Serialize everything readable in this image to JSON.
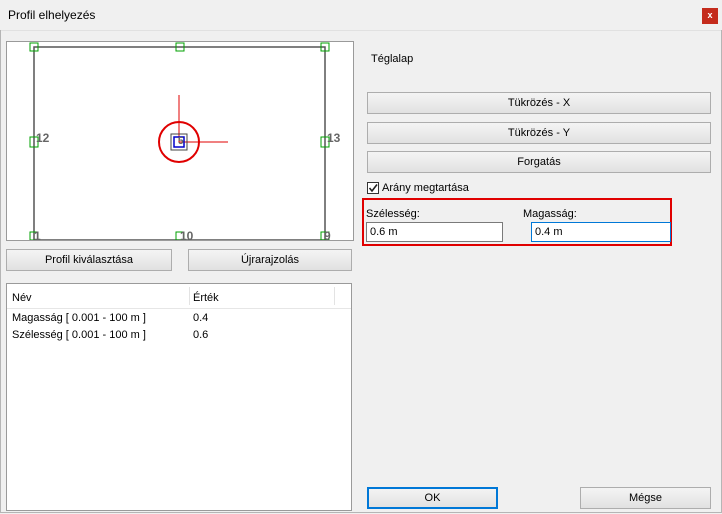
{
  "window": {
    "title": "Profil elhelyezés",
    "close_label": "x"
  },
  "preview": {
    "point_labels": [
      "12",
      "13",
      "1",
      "10",
      "9",
      "5"
    ]
  },
  "left_buttons": {
    "select_profile": "Profil kiválasztása",
    "redraw": "Újrarajzolás"
  },
  "properties": {
    "columns": [
      "Név",
      "Érték"
    ],
    "rows": [
      {
        "name": "Magasság [ 0.001 - 100 m ]",
        "value": "0.4"
      },
      {
        "name": "Szélesség [ 0.001 - 100 m ]",
        "value": "0.6"
      }
    ]
  },
  "shape_type": "Téglalap",
  "actions": {
    "mirror_x": "Tükrözés - X",
    "mirror_y": "Tükrözés - Y",
    "rotate": "Forgatás"
  },
  "keep_ratio": {
    "label": "Arány megtartása",
    "checked": true
  },
  "dimensions": {
    "width_label": "Szélesség:",
    "width_value": "0.6 m",
    "height_label": "Magasság:",
    "height_value": "0.4 m"
  },
  "footer": {
    "ok": "OK",
    "cancel": "Mégse"
  },
  "colors": {
    "highlight": "#e00000",
    "handle": "#00a000",
    "crosshair": "#e00000",
    "focus": "#0078d7"
  }
}
